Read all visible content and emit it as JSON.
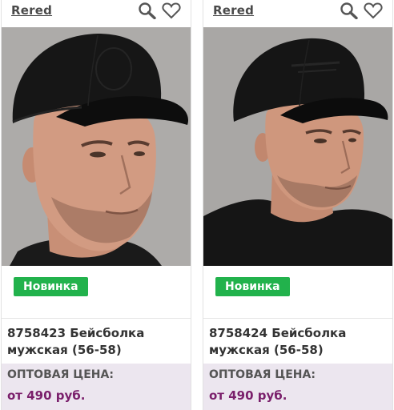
{
  "products": [
    {
      "brand": "Rered",
      "badge": "Новинка",
      "name": "8758423 Бейсболка мужская (56-58)",
      "price_label": "ОПТОВАЯ ЦЕНА:",
      "price": "от 490 руб."
    },
    {
      "brand": "Rered",
      "badge": "Новинка",
      "name": "8758424 Бейсболка мужская (56-58)",
      "price_label": "ОПТОВАЯ ЦЕНА:",
      "price": "от 490 руб."
    }
  ],
  "icons": [
    "search-icon",
    "heart-icon"
  ],
  "colors": {
    "badge": "#22b24c",
    "price_bg": "#ece6ef",
    "price_text": "#7a1f6b",
    "cap": "#141414"
  }
}
